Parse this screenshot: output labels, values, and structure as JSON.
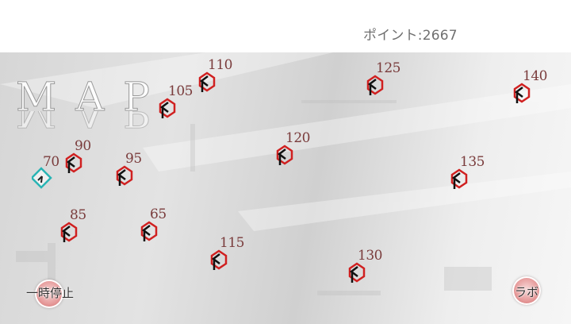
{
  "header": {
    "points_text": "ポイント:2667"
  },
  "map": {
    "title": "MAP"
  },
  "nodes": [
    {
      "label": "70",
      "state": "current"
    },
    {
      "label": "90",
      "state": "locked"
    },
    {
      "label": "95",
      "state": "locked"
    },
    {
      "label": "105",
      "state": "locked"
    },
    {
      "label": "110",
      "state": "locked"
    },
    {
      "label": "85",
      "state": "locked"
    },
    {
      "label": "65",
      "state": "locked"
    },
    {
      "label": "115",
      "state": "locked"
    },
    {
      "label": "120",
      "state": "locked"
    },
    {
      "label": "125",
      "state": "locked"
    },
    {
      "label": "130",
      "state": "locked"
    },
    {
      "label": "135",
      "state": "locked"
    },
    {
      "label": "140",
      "state": "locked"
    }
  ],
  "buttons": {
    "pause_label": "一時停止",
    "lab_label": "ラボ"
  },
  "colors": {
    "locked": "#d02020",
    "current": "#28b4b4",
    "number": "#7a3c3c"
  }
}
